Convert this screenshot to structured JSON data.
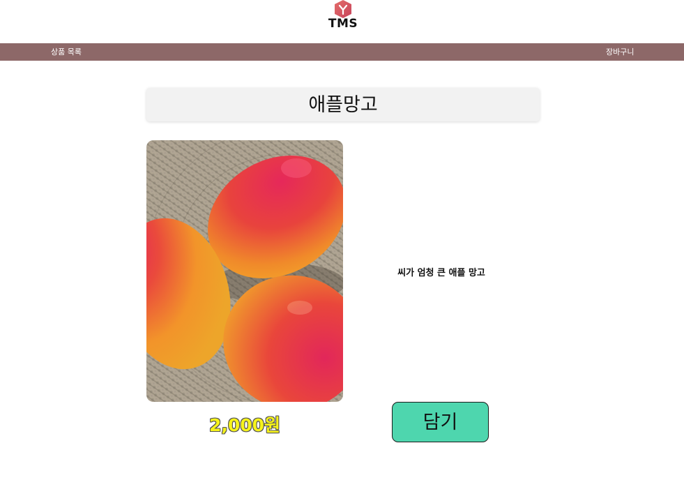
{
  "header": {
    "logo_text": "TMS",
    "logo_color": "#d9545e"
  },
  "nav": {
    "products_label": "상품 목록",
    "cart_label": "장바구니",
    "background": "#8d6868"
  },
  "product": {
    "name": "애플망고",
    "description": "씨가 엄청 큰 애플 망고",
    "price": "2,000원",
    "image_subject": "three apple mangoes on a woven placemat",
    "add_button_label": "담기",
    "add_button_color": "#4ed6ae",
    "price_color": "#f6f31b"
  }
}
